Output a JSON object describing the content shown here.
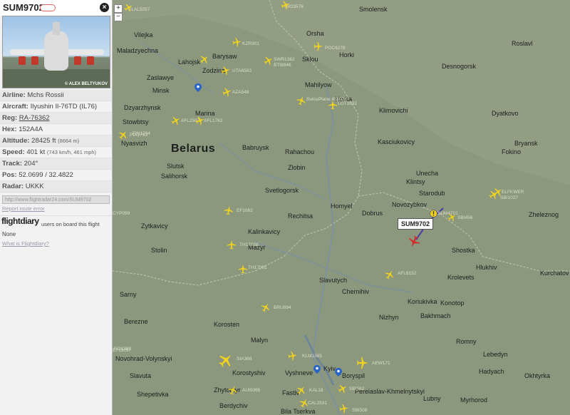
{
  "flight": {
    "callsign": "SUM9702",
    "photo_credit": "© ALEX BELTYUKOV",
    "close_label": "×"
  },
  "info": [
    {
      "key": "Airline:",
      "value": "Mchs Rossii",
      "extra": ""
    },
    {
      "key": "Aircraft:",
      "value": "Ilyushin Il-76TD (IL76)",
      "extra": ""
    },
    {
      "key": "Reg:",
      "value": "RA-76362",
      "extra": ""
    },
    {
      "key": "Hex:",
      "value": "152A4A",
      "extra": ""
    },
    {
      "key": "Altitude:",
      "value": "28425 ft",
      "extra": "(8664 m)"
    },
    {
      "key": "Speed:",
      "value": "401 kt",
      "extra": "(743 km/h, 461 mph)"
    },
    {
      "key": "Track:",
      "value": "204°",
      "extra": ""
    },
    {
      "key": "Pos:",
      "value": "52.0699 / 32.4822",
      "extra": ""
    },
    {
      "key": "Radar:",
      "value": "UKKK",
      "extra": ""
    }
  ],
  "share": {
    "url": "http://www.flightradar24.com/SUM9702",
    "report_label": "Report route error"
  },
  "flightdiary": {
    "logo": "flightdiary",
    "tagline": "users on board this flight",
    "none_label": "None",
    "what_label": "What is Flightdiary?"
  },
  "map": {
    "zoom_in": "+",
    "zoom_out": "−",
    "country": "Belarus",
    "selected_label": "SUM9702",
    "cities": [
      {
        "name": "Smolensk"
      },
      {
        "name": "Orsha"
      },
      {
        "name": "Vilejka"
      },
      {
        "name": "Maladzyechna"
      },
      {
        "name": "Barysaw"
      },
      {
        "name": "Lahojsk"
      },
      {
        "name": "Zodzina"
      },
      {
        "name": "Sklou"
      },
      {
        "name": "Horki"
      },
      {
        "name": "Zaslawye"
      },
      {
        "name": "Minsk"
      },
      {
        "name": "Mahilyow"
      },
      {
        "name": "Roslavl"
      },
      {
        "name": "Desnogorsk"
      },
      {
        "name": "Dzyarzhynsk"
      },
      {
        "name": "Marina"
      },
      {
        "name": "Horka"
      },
      {
        "name": "Klimovichi"
      },
      {
        "name": "Stowbtsy"
      },
      {
        "name": "Dyatkovo"
      },
      {
        "name": "Nyasvizh"
      },
      {
        "name": "Babruysk"
      },
      {
        "name": "Rahachou"
      },
      {
        "name": "Kasciukovicy"
      },
      {
        "name": "Bryansk"
      },
      {
        "name": "Fokino"
      },
      {
        "name": "Slutsk"
      },
      {
        "name": "Salihorsk"
      },
      {
        "name": "Zlobin"
      },
      {
        "name": "Unecha"
      },
      {
        "name": "Klintsy"
      },
      {
        "name": "Starodub"
      },
      {
        "name": "Svetlogorsk"
      },
      {
        "name": "Homyel"
      },
      {
        "name": "Dobrus"
      },
      {
        "name": "Novozybkov"
      },
      {
        "name": "Zheleznog"
      },
      {
        "name": "Zytkavicy"
      },
      {
        "name": "Rechitsa"
      },
      {
        "name": "Kalinkavicy"
      },
      {
        "name": "Mazyr"
      },
      {
        "name": "Stolin"
      },
      {
        "name": "Shostka"
      },
      {
        "name": "Hlukhiv"
      },
      {
        "name": "Kurchatov"
      },
      {
        "name": "Slavutych"
      },
      {
        "name": "Krolevets"
      },
      {
        "name": "Chernihiv"
      },
      {
        "name": "Sarny"
      },
      {
        "name": "Koriukivka"
      },
      {
        "name": "Konotop"
      },
      {
        "name": "Bakhmach"
      },
      {
        "name": "Nizhyn"
      },
      {
        "name": "Berezne"
      },
      {
        "name": "Korosten"
      },
      {
        "name": "Romny"
      },
      {
        "name": "Malyn"
      },
      {
        "name": "Novohrad-Volynskyi"
      },
      {
        "name": "Lebedyn"
      },
      {
        "name": "Korostyshiv"
      },
      {
        "name": "Vyshneve"
      },
      {
        "name": "Kyiv"
      },
      {
        "name": "Boryspil"
      },
      {
        "name": "Hadyach"
      },
      {
        "name": "Slavuta"
      },
      {
        "name": "Zhytomyr"
      },
      {
        "name": "Pereiaslav-Khmelnytskyi"
      },
      {
        "name": "Lubny"
      },
      {
        "name": "Okhtyrka"
      },
      {
        "name": "Shepetivka"
      },
      {
        "name": "Fastiv"
      },
      {
        "name": "Myrhorod"
      },
      {
        "name": "Berdychiv"
      },
      {
        "name": "Bila Tserkva"
      }
    ],
    "aircraft_labels": [
      "KZR901",
      "SWR1382",
      "BTI8846",
      "UTA6583",
      "AZA548",
      "PGC6278",
      "TSO3576",
      "SwissPlane 456026",
      "AFL2507",
      "LOT3532",
      "ELAL5057",
      "ELFKWER",
      "SBI1027",
      "AFL1762",
      "PIA1793",
      "EF11057",
      "FIN1704",
      "SUM4701",
      "CYP099",
      "EF1062",
      "SBI456",
      "TH17026",
      "TH17001",
      "AFL6152",
      "BRU894",
      "SIA368",
      "KLM1385",
      "AEW171",
      "FOX392",
      "AUI9365",
      "KAL18",
      "SBI562",
      "CAL2531",
      "SBI508"
    ],
    "icons": [
      "airplane-icon",
      "map-pin-icon",
      "warning-icon"
    ]
  }
}
